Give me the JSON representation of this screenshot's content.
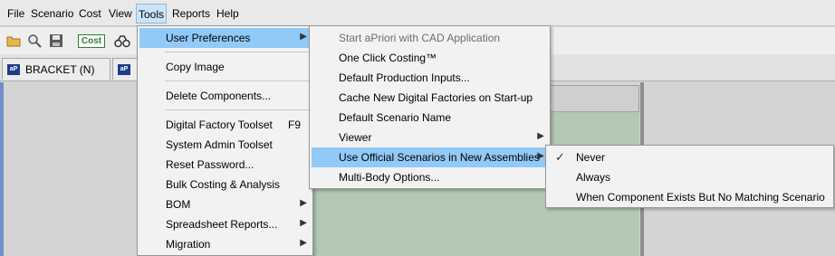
{
  "menubar": {
    "items": [
      {
        "label": "File"
      },
      {
        "label": "Scenario"
      },
      {
        "label": "Cost"
      },
      {
        "label": "View"
      },
      {
        "label": "Tools"
      },
      {
        "label": "Reports"
      },
      {
        "label": "Help"
      }
    ]
  },
  "toolbar": {
    "icons": [
      "open-folder-icon",
      "search-icon",
      "save-icon",
      "compare-icon"
    ],
    "cost_label": "Cost"
  },
  "tabs": [
    {
      "badge": "aP",
      "label": "BRACKET (N)"
    },
    {
      "badge": "aP",
      "label": ""
    }
  ],
  "tools_menu": {
    "items": [
      {
        "label": "User Preferences",
        "submenu": true,
        "highlighted": true
      },
      {
        "label": "Copy Image"
      },
      {
        "label": "Delete Components..."
      },
      {
        "label": "Digital Factory Toolset",
        "shortcut": "F9"
      },
      {
        "label": "System Admin Toolset"
      },
      {
        "label": "Reset Password..."
      },
      {
        "label": "Bulk Costing & Analysis"
      },
      {
        "label": "BOM",
        "submenu": true
      },
      {
        "label": "Spreadsheet Reports...",
        "submenu": true
      },
      {
        "label": "Migration",
        "submenu": true
      }
    ]
  },
  "user_prefs_menu": {
    "items": [
      {
        "label": "Start aPriori with CAD Application",
        "disabled": true
      },
      {
        "label": "One Click Costing™"
      },
      {
        "label": "Default Production Inputs..."
      },
      {
        "label": "Cache New Digital Factories on Start-up"
      },
      {
        "label": "Default Scenario Name"
      },
      {
        "label": "Viewer",
        "submenu": true
      },
      {
        "label": "Use Official Scenarios in New Assemblies",
        "submenu": true,
        "highlighted": true
      },
      {
        "label": "Multi-Body Options..."
      }
    ]
  },
  "official_scenarios_menu": {
    "items": [
      {
        "label": "Never",
        "checked": true
      },
      {
        "label": "Always"
      },
      {
        "label": "When Component Exists But No Matching Scenario"
      }
    ]
  },
  "colors": {
    "menu_highlight": "#91c9f7",
    "workspace_green": "#b2c8b3",
    "cost_green": "#2e7d32"
  }
}
